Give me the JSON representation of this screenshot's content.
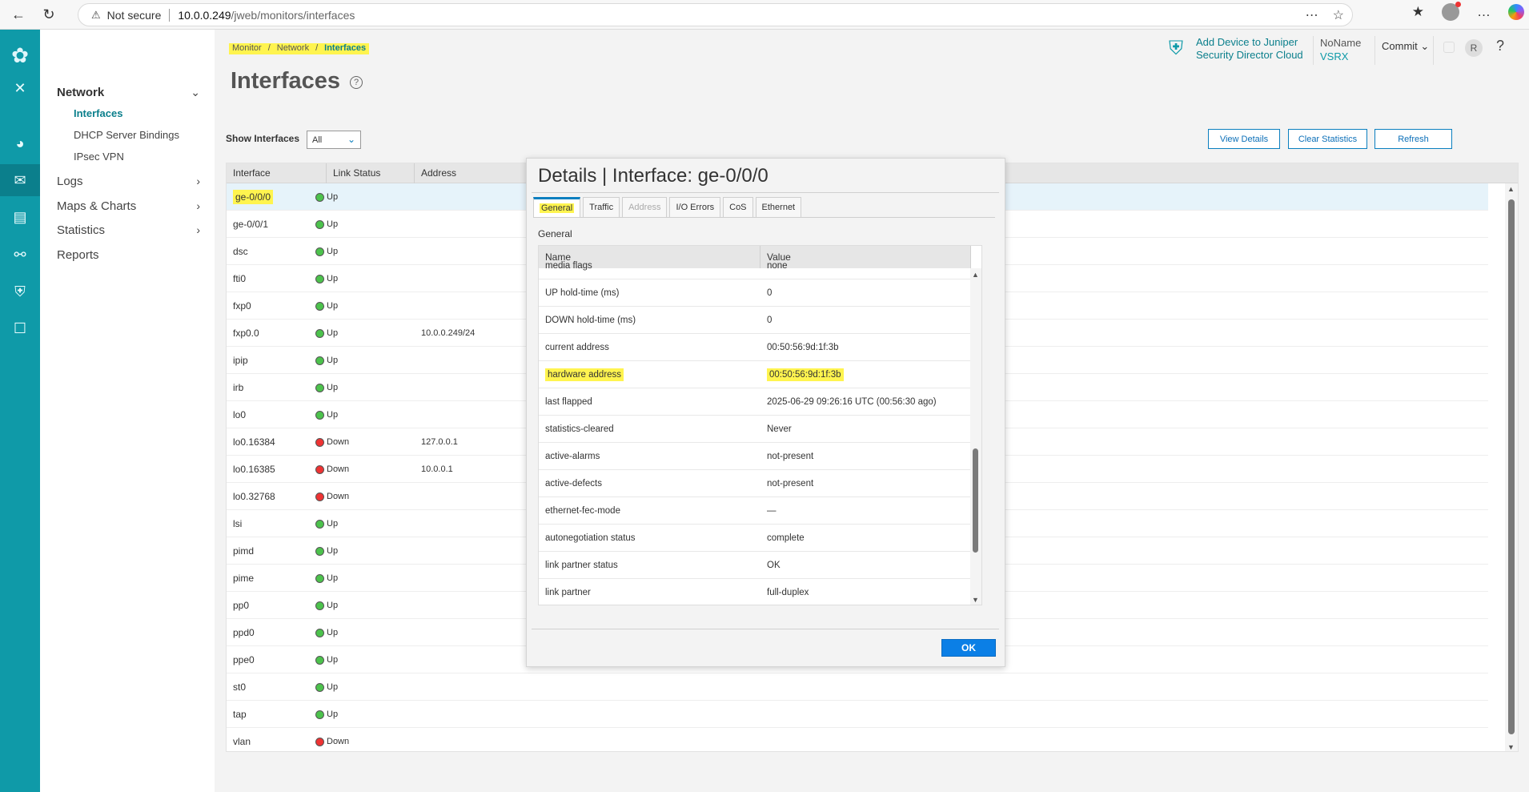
{
  "browser": {
    "security_label": "Not secure",
    "url_host": "10.0.0.249",
    "url_path": "/jweb/monitors/interfaces"
  },
  "sidenav": {
    "network_label": "Network",
    "network_items": [
      {
        "label": "Interfaces",
        "active": true
      },
      {
        "label": "DHCP Server Bindings",
        "active": false
      },
      {
        "label": "IPsec VPN",
        "active": false
      }
    ],
    "logs_label": "Logs",
    "maps_label": "Maps & Charts",
    "statistics_label": "Statistics",
    "reports_label": "Reports"
  },
  "breadcrumb": {
    "monitor": "Monitor",
    "network": "Network",
    "current": "Interfaces",
    "separator": "/"
  },
  "page": {
    "title": "Interfaces",
    "help": "?"
  },
  "topbar": {
    "jsdc_line1": "Add Device to Juniper",
    "jsdc_line2": "Security Director Cloud",
    "device_name": "NoName",
    "device_model": "VSRX",
    "commit_label": "Commit",
    "avatar_initial": "R",
    "help": "?"
  },
  "toolbar": {
    "show_label": "Show Interfaces",
    "show_value": "All",
    "view_details": "View Details",
    "clear_statistics": "Clear Statistics",
    "refresh": "Refresh"
  },
  "interfaces_table": {
    "columns": [
      "Interface",
      "Link Status",
      "Address"
    ],
    "rows": [
      {
        "interface": "ge-0/0/0",
        "status": "Up",
        "address": ""
      },
      {
        "interface": "ge-0/0/1",
        "status": "Up",
        "address": ""
      },
      {
        "interface": "dsc",
        "status": "Up",
        "address": ""
      },
      {
        "interface": "fti0",
        "status": "Up",
        "address": ""
      },
      {
        "interface": "fxp0",
        "status": "Up",
        "address": ""
      },
      {
        "interface": "fxp0.0",
        "status": "Up",
        "address": "10.0.0.249/24"
      },
      {
        "interface": "ipip",
        "status": "Up",
        "address": ""
      },
      {
        "interface": "irb",
        "status": "Up",
        "address": ""
      },
      {
        "interface": "lo0",
        "status": "Up",
        "address": ""
      },
      {
        "interface": "lo0.16384",
        "status": "Down",
        "address": "127.0.0.1"
      },
      {
        "interface": "lo0.16385",
        "status": "Down",
        "address": "10.0.0.1"
      },
      {
        "interface": "lo0.32768",
        "status": "Down",
        "address": ""
      },
      {
        "interface": "lsi",
        "status": "Up",
        "address": ""
      },
      {
        "interface": "pimd",
        "status": "Up",
        "address": ""
      },
      {
        "interface": "pime",
        "status": "Up",
        "address": ""
      },
      {
        "interface": "pp0",
        "status": "Up",
        "address": ""
      },
      {
        "interface": "ppd0",
        "status": "Up",
        "address": ""
      },
      {
        "interface": "ppe0",
        "status": "Up",
        "address": ""
      },
      {
        "interface": "st0",
        "status": "Up",
        "address": ""
      },
      {
        "interface": "tap",
        "status": "Up",
        "address": ""
      },
      {
        "interface": "vlan",
        "status": "Down",
        "address": ""
      }
    ]
  },
  "dialog": {
    "title": "Details | Interface: ge-0/0/0",
    "tabs": [
      {
        "label": "General",
        "state": "active"
      },
      {
        "label": "Traffic",
        "state": "normal"
      },
      {
        "label": "Address",
        "state": "disabled"
      },
      {
        "label": "I/O Errors",
        "state": "normal"
      },
      {
        "label": "CoS",
        "state": "normal"
      },
      {
        "label": "Ethernet",
        "state": "normal"
      }
    ],
    "section": "General",
    "columns": [
      "Name",
      "Value"
    ],
    "rows": [
      {
        "name": "media flags",
        "value": "none"
      },
      {
        "name": "UP hold-time (ms)",
        "value": "0"
      },
      {
        "name": "DOWN hold-time (ms)",
        "value": "0"
      },
      {
        "name": "current address",
        "value": "00:50:56:9d:1f:3b"
      },
      {
        "name": "hardware address",
        "value": "00:50:56:9d:1f:3b"
      },
      {
        "name": "last flapped",
        "value": "2025-06-29 09:26:16 UTC (00:56:30 ago)"
      },
      {
        "name": "statistics-cleared",
        "value": "Never"
      },
      {
        "name": "active-alarms",
        "value": "not-present"
      },
      {
        "name": "active-defects",
        "value": "not-present"
      },
      {
        "name": "ethernet-fec-mode",
        "value": "—"
      },
      {
        "name": "autonegotiation status",
        "value": "complete"
      },
      {
        "name": "link partner status",
        "value": "OK"
      },
      {
        "name": "link partner",
        "value": "full-duplex"
      }
    ],
    "ok_label": "OK"
  },
  "colors": {
    "rail": "#0f9aa8",
    "accent": "#0b7f8c",
    "button_blue": "#0b7fe6",
    "highlight": "#fff44f",
    "status_up": "#4cc24c",
    "status_down": "#e33333"
  }
}
